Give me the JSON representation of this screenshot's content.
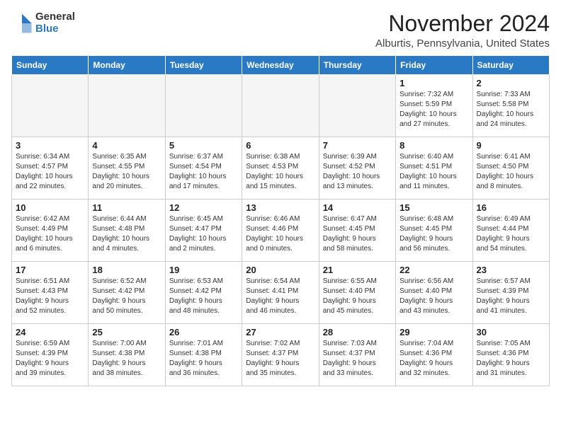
{
  "logo": {
    "general": "General",
    "blue": "Blue"
  },
  "title": "November 2024",
  "location": "Alburtis, Pennsylvania, United States",
  "days_of_week": [
    "Sunday",
    "Monday",
    "Tuesday",
    "Wednesday",
    "Thursday",
    "Friday",
    "Saturday"
  ],
  "weeks": [
    [
      {
        "day": "",
        "detail": ""
      },
      {
        "day": "",
        "detail": ""
      },
      {
        "day": "",
        "detail": ""
      },
      {
        "day": "",
        "detail": ""
      },
      {
        "day": "",
        "detail": ""
      },
      {
        "day": "1",
        "detail": "Sunrise: 7:32 AM\nSunset: 5:59 PM\nDaylight: 10 hours\nand 27 minutes."
      },
      {
        "day": "2",
        "detail": "Sunrise: 7:33 AM\nSunset: 5:58 PM\nDaylight: 10 hours\nand 24 minutes."
      }
    ],
    [
      {
        "day": "3",
        "detail": "Sunrise: 6:34 AM\nSunset: 4:57 PM\nDaylight: 10 hours\nand 22 minutes."
      },
      {
        "day": "4",
        "detail": "Sunrise: 6:35 AM\nSunset: 4:55 PM\nDaylight: 10 hours\nand 20 minutes."
      },
      {
        "day": "5",
        "detail": "Sunrise: 6:37 AM\nSunset: 4:54 PM\nDaylight: 10 hours\nand 17 minutes."
      },
      {
        "day": "6",
        "detail": "Sunrise: 6:38 AM\nSunset: 4:53 PM\nDaylight: 10 hours\nand 15 minutes."
      },
      {
        "day": "7",
        "detail": "Sunrise: 6:39 AM\nSunset: 4:52 PM\nDaylight: 10 hours\nand 13 minutes."
      },
      {
        "day": "8",
        "detail": "Sunrise: 6:40 AM\nSunset: 4:51 PM\nDaylight: 10 hours\nand 11 minutes."
      },
      {
        "day": "9",
        "detail": "Sunrise: 6:41 AM\nSunset: 4:50 PM\nDaylight: 10 hours\nand 8 minutes."
      }
    ],
    [
      {
        "day": "10",
        "detail": "Sunrise: 6:42 AM\nSunset: 4:49 PM\nDaylight: 10 hours\nand 6 minutes."
      },
      {
        "day": "11",
        "detail": "Sunrise: 6:44 AM\nSunset: 4:48 PM\nDaylight: 10 hours\nand 4 minutes."
      },
      {
        "day": "12",
        "detail": "Sunrise: 6:45 AM\nSunset: 4:47 PM\nDaylight: 10 hours\nand 2 minutes."
      },
      {
        "day": "13",
        "detail": "Sunrise: 6:46 AM\nSunset: 4:46 PM\nDaylight: 10 hours\nand 0 minutes."
      },
      {
        "day": "14",
        "detail": "Sunrise: 6:47 AM\nSunset: 4:45 PM\nDaylight: 9 hours\nand 58 minutes."
      },
      {
        "day": "15",
        "detail": "Sunrise: 6:48 AM\nSunset: 4:45 PM\nDaylight: 9 hours\nand 56 minutes."
      },
      {
        "day": "16",
        "detail": "Sunrise: 6:49 AM\nSunset: 4:44 PM\nDaylight: 9 hours\nand 54 minutes."
      }
    ],
    [
      {
        "day": "17",
        "detail": "Sunrise: 6:51 AM\nSunset: 4:43 PM\nDaylight: 9 hours\nand 52 minutes."
      },
      {
        "day": "18",
        "detail": "Sunrise: 6:52 AM\nSunset: 4:42 PM\nDaylight: 9 hours\nand 50 minutes."
      },
      {
        "day": "19",
        "detail": "Sunrise: 6:53 AM\nSunset: 4:42 PM\nDaylight: 9 hours\nand 48 minutes."
      },
      {
        "day": "20",
        "detail": "Sunrise: 6:54 AM\nSunset: 4:41 PM\nDaylight: 9 hours\nand 46 minutes."
      },
      {
        "day": "21",
        "detail": "Sunrise: 6:55 AM\nSunset: 4:40 PM\nDaylight: 9 hours\nand 45 minutes."
      },
      {
        "day": "22",
        "detail": "Sunrise: 6:56 AM\nSunset: 4:40 PM\nDaylight: 9 hours\nand 43 minutes."
      },
      {
        "day": "23",
        "detail": "Sunrise: 6:57 AM\nSunset: 4:39 PM\nDaylight: 9 hours\nand 41 minutes."
      }
    ],
    [
      {
        "day": "24",
        "detail": "Sunrise: 6:59 AM\nSunset: 4:39 PM\nDaylight: 9 hours\nand 39 minutes."
      },
      {
        "day": "25",
        "detail": "Sunrise: 7:00 AM\nSunset: 4:38 PM\nDaylight: 9 hours\nand 38 minutes."
      },
      {
        "day": "26",
        "detail": "Sunrise: 7:01 AM\nSunset: 4:38 PM\nDaylight: 9 hours\nand 36 minutes."
      },
      {
        "day": "27",
        "detail": "Sunrise: 7:02 AM\nSunset: 4:37 PM\nDaylight: 9 hours\nand 35 minutes."
      },
      {
        "day": "28",
        "detail": "Sunrise: 7:03 AM\nSunset: 4:37 PM\nDaylight: 9 hours\nand 33 minutes."
      },
      {
        "day": "29",
        "detail": "Sunrise: 7:04 AM\nSunset: 4:36 PM\nDaylight: 9 hours\nand 32 minutes."
      },
      {
        "day": "30",
        "detail": "Sunrise: 7:05 AM\nSunset: 4:36 PM\nDaylight: 9 hours\nand 31 minutes."
      }
    ]
  ]
}
